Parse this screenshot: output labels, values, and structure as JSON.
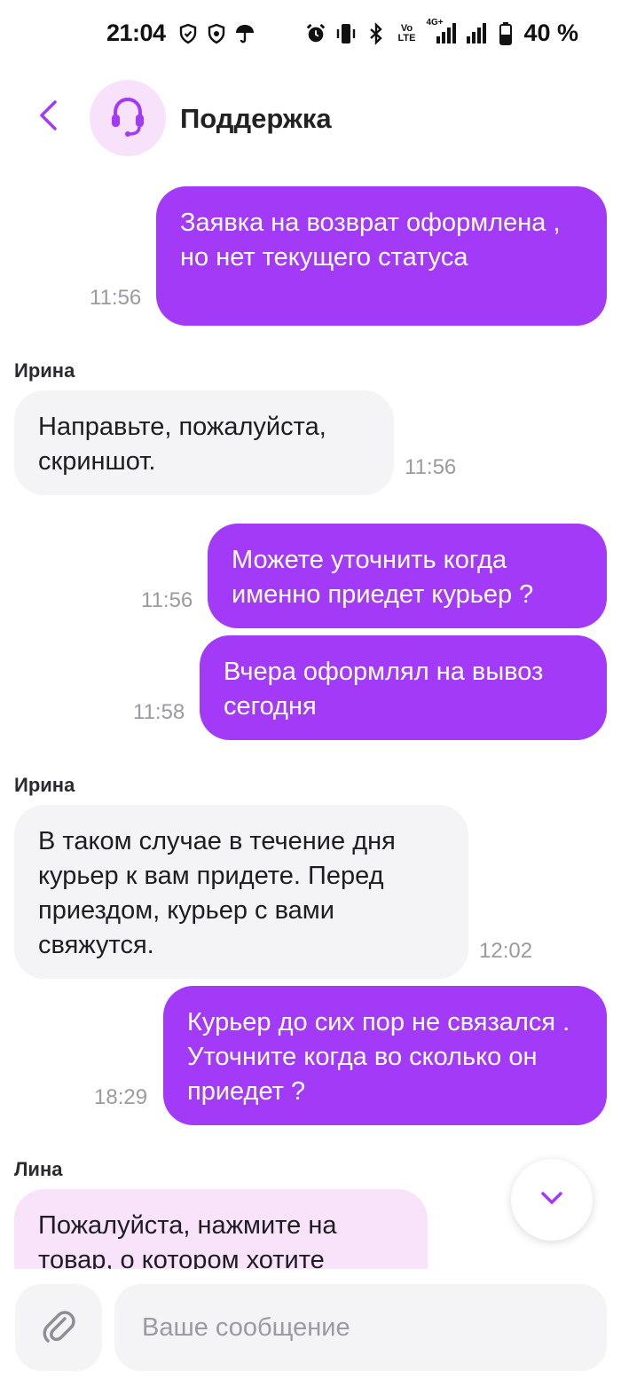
{
  "status_bar": {
    "time": "21:04",
    "battery": "40 %",
    "volte": "Vo LTE",
    "network": "4G+",
    "icons": [
      "shield-icon",
      "shield-icon",
      "umbrella-icon",
      "alarm-icon",
      "vibrate-icon",
      "bluetooth-icon",
      "volte-icon",
      "signal-icon",
      "signal-icon",
      "battery-icon"
    ]
  },
  "header": {
    "title": "Поддержка",
    "back_icon": "chevron-left-icon",
    "avatar_icon": "headset-icon",
    "accent_color": "#a23af7"
  },
  "messages": [
    {
      "direction": "out",
      "text": "Заявка на возврат оформлена , но нет текущего статуса",
      "time": "11:56"
    },
    {
      "direction": "in",
      "sender": "Ирина",
      "text": "Направьте, пожалуйста, скриншот.",
      "time": "11:56"
    },
    {
      "direction": "out",
      "text": "Можете уточнить когда именно приедет курьер ?",
      "time": "11:56"
    },
    {
      "direction": "out",
      "text": "Вчера оформлял на вывоз сегодня",
      "time": "11:58"
    },
    {
      "direction": "in",
      "sender": "Ирина",
      "text": "В таком случае в течение дня курьер к вам придете. Перед приездом, курьер с вами свяжутся.",
      "time": "12:02"
    },
    {
      "direction": "out",
      "text": "Курьер до сих пор не связался . Уточните когда во сколько он приедет ?",
      "time": "18:29"
    },
    {
      "direction": "in",
      "sender": "Лина",
      "text": "Пожалуйста, нажмите на товар, о котором хотите",
      "time": ""
    }
  ],
  "composer": {
    "placeholder": "Ваше сообщение",
    "value": "",
    "attach_icon": "paperclip-icon"
  },
  "scroll_down_icon": "chevron-down-icon"
}
